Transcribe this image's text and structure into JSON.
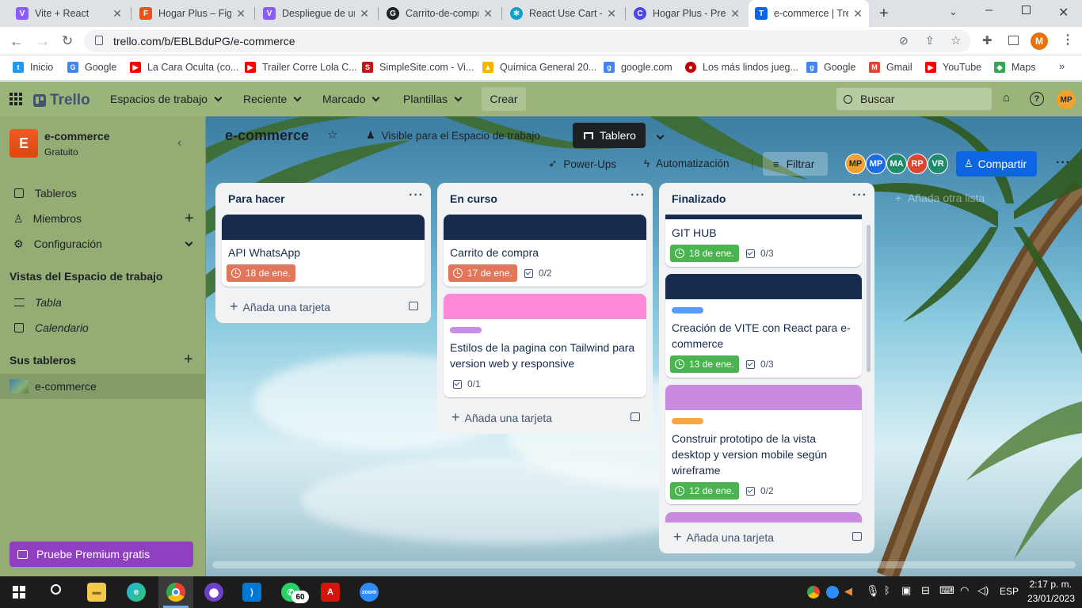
{
  "browser": {
    "tabs": [
      {
        "title": "Vite + React",
        "fav": "V",
        "color": "#8b5cf6"
      },
      {
        "title": "Hogar Plus – Figma",
        "fav": "F",
        "color": "#f24e1e"
      },
      {
        "title": "Despliegue de una",
        "fav": "V",
        "color": "#8b5cf6"
      },
      {
        "title": "Carrito-de-compra",
        "fav": "G",
        "color": "#1f2328"
      },
      {
        "title": "React Use Cart - n",
        "fav": "⚛",
        "color": "#149eca"
      },
      {
        "title": "Hogar Plus - Prese",
        "fav": "C",
        "color": "#4f46e5"
      },
      {
        "title": "e-commerce | Trello",
        "fav": "T",
        "color": "#0c66e4"
      }
    ],
    "url": "trello.com/b/EBLBduPG/e-commerce",
    "bookmarks": [
      {
        "label": "Inicio",
        "icon": "twitter-icon",
        "color": "#1d9bf0"
      },
      {
        "label": "Google",
        "icon": "google-icon",
        "color": "#4285f4"
      },
      {
        "label": "La Cara Oculta (co...",
        "icon": "youtube-icon",
        "color": "#ff0000"
      },
      {
        "label": "Trailer Corre Lola C...",
        "icon": "youtube-icon",
        "color": "#ff0000"
      },
      {
        "label": "SimpleSite.com - Vi...",
        "icon": "simplesite-icon",
        "color": "#c4161c"
      },
      {
        "label": "Química General 20...",
        "icon": "drive-icon",
        "color": "#f4b400"
      },
      {
        "label": "google.com",
        "icon": "google-search-icon",
        "color": "#4285f4"
      },
      {
        "label": "Los más lindos jueg...",
        "icon": "game-icon",
        "color": "#c00000"
      },
      {
        "label": "Google",
        "icon": "google-search-icon",
        "color": "#4285f4"
      },
      {
        "label": "Gmail",
        "icon": "gmail-icon",
        "color": "#ea4335"
      },
      {
        "label": "YouTube",
        "icon": "youtube-icon",
        "color": "#ff0000"
      },
      {
        "label": "Maps",
        "icon": "maps-icon",
        "color": "#34a853"
      }
    ],
    "profile_initial": "M"
  },
  "header": {
    "logo": "Trello",
    "nav": [
      "Espacios de trabajo",
      "Reciente",
      "Marcado",
      "Plantillas"
    ],
    "create": "Crear",
    "search_placeholder": "Buscar",
    "user_initials": "MP"
  },
  "sidebar": {
    "workspace_initial": "E",
    "workspace_name": "e-commerce",
    "workspace_plan": "Gratuito",
    "items": [
      {
        "label": "Tableros"
      },
      {
        "label": "Miembros"
      },
      {
        "label": "Configuración"
      }
    ],
    "views_title": "Vistas del Espacio de trabajo",
    "views": [
      {
        "label": "Tabla"
      },
      {
        "label": "Calendario"
      }
    ],
    "boards_title": "Sus tableros",
    "boards": [
      {
        "label": "e-commerce"
      }
    ],
    "premium": "Pruebe Premium gratis"
  },
  "board": {
    "title": "e-commerce",
    "visibility": "Visible para el Espacio de trabajo",
    "view": "Tablero",
    "powerups": "Power-Ups",
    "automation": "Automatización",
    "filter": "Filtrar",
    "share": "Compartir",
    "members": [
      {
        "initials": "MP",
        "color": "#f2a12e"
      },
      {
        "initials": "MP",
        "color": "#1d6ae5"
      },
      {
        "initials": "MA",
        "color": "#1f8b6a"
      },
      {
        "initials": "RP",
        "color": "#e0452f"
      },
      {
        "initials": "VR",
        "color": "#1f8b6a"
      }
    ],
    "add_another_list": "Añada otra lista",
    "add_card": "Añada una tarjeta",
    "lists": [
      {
        "title": "Para hacer",
        "cards": [
          {
            "title": "API WhatsApp",
            "date": "18 de ene.",
            "date_color": "#e2765a"
          }
        ]
      },
      {
        "title": "En curso",
        "cards": [
          {
            "title": "Carrito de compra",
            "date": "17 de ene.",
            "date_color": "#e2765a",
            "checklist": "0/2"
          },
          {
            "title": "Estilos de la pagina con Tailwind para version web y responsive",
            "label_color": "#c88de8",
            "checklist": "0/1"
          }
        ]
      },
      {
        "title": "Finalizado",
        "cards": [
          {
            "title": "GIT HUB",
            "date": "18 de ene.",
            "date_color": "#4bb34f",
            "checklist": "0/3"
          },
          {
            "title": "Creación de VITE con React para e-commerce",
            "label_color": "#579dff",
            "date": "13 de ene.",
            "date_color": "#4bb34f",
            "checklist": "0/3"
          },
          {
            "title": "Construir prototipo de la vista desktop y version mobile según wireframe",
            "label_color": "#f5a742",
            "date": "12 de ene.",
            "date_color": "#4bb34f",
            "checklist": "0/2"
          }
        ]
      }
    ]
  },
  "taskbar": {
    "time": "2:17 p. m.",
    "date": "23/01/2023",
    "lang": "ESP",
    "whatsapp_badge": "60"
  }
}
